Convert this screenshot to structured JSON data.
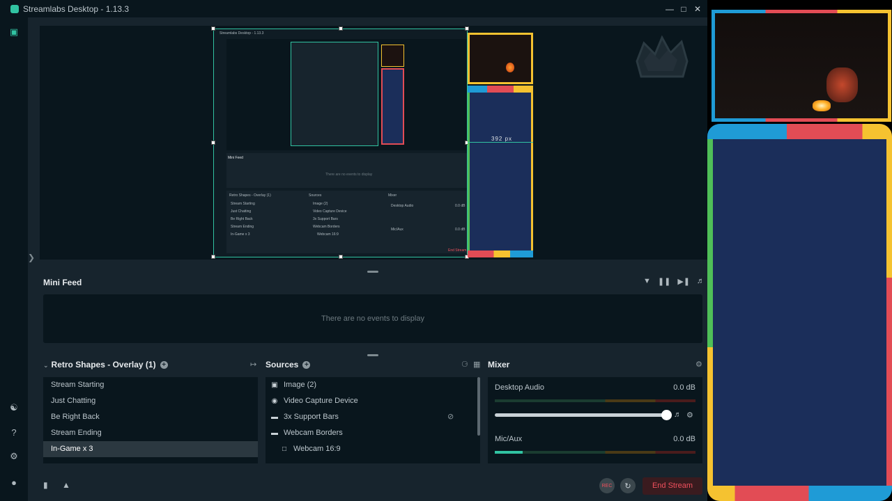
{
  "window": {
    "title": "Streamlabs Desktop - 1.13.3",
    "controls": [
      "minimize",
      "maximize",
      "close"
    ]
  },
  "nav": {
    "icons": [
      "studio-icon",
      "themes-icon",
      "help-icon",
      "settings-icon",
      "profile-icon"
    ]
  },
  "preview": {
    "nested_title": "Streamlabs Desktop - 1.13.3",
    "nested_feed_label": "Mini Feed",
    "nested_feed_empty": "There are no events to display",
    "nested_scenes_label": "Retro Shapes - Overlay (1)",
    "nested_sources_label": "Sources",
    "nested_mixer_label": "Mixer",
    "nested_desktop_audio": "Desktop Audio",
    "nested_mic": "Mic/Aux",
    "nested_db": "0.0 dB",
    "nested_end": "End Stream",
    "nested_scenes": [
      "Stream Starting",
      "Just Chatting",
      "Be Right Back",
      "Stream Ending",
      "In-Game x 3"
    ],
    "nested_sources": [
      "Image (2)",
      "Video Capture Device",
      "3x Support Bars",
      "Webcam Borders",
      "Webcam 16:9"
    ],
    "bar_height_label": "392 px"
  },
  "mini_feed": {
    "title": "Mini Feed",
    "empty_text": "There are no events to display",
    "tools": [
      "filter-icon",
      "pause-icon",
      "skip-icon",
      "volume-icon"
    ]
  },
  "scenes": {
    "title": "Retro Shapes - Overlay (1)",
    "items": [
      {
        "label": "Stream Starting",
        "active": false
      },
      {
        "label": "Just Chatting",
        "active": false
      },
      {
        "label": "Be Right Back",
        "active": false
      },
      {
        "label": "Stream Ending",
        "active": false
      },
      {
        "label": "In-Game x 3",
        "active": true
      }
    ]
  },
  "sources": {
    "title": "Sources",
    "items": [
      {
        "label": "Image (2)",
        "icon": "image-icon"
      },
      {
        "label": "Video Capture Device",
        "icon": "webcam-icon"
      },
      {
        "label": "3x Support Bars",
        "icon": "folder-icon"
      },
      {
        "label": "Webcam Borders",
        "icon": "folder-open-icon"
      },
      {
        "label": "Webcam 16:9",
        "icon": "file-icon"
      }
    ]
  },
  "mixer": {
    "title": "Mixer",
    "channels": [
      {
        "name": "Desktop Audio",
        "db": "0.0 dB",
        "level": 0.0
      },
      {
        "name": "Mic/Aux",
        "db": "0.0 dB",
        "level": 0.14
      }
    ],
    "volume": 0.88
  },
  "footer": {
    "rec_label": "REC",
    "end_stream": "End Stream"
  },
  "colors": {
    "accent": "#31c3a2",
    "panel_bg": "#17242d",
    "dark_bg": "#09161d",
    "end_stream_text": "#f0505d",
    "overlay_blue": "#1f9bd6",
    "overlay_red": "#e24c55",
    "overlay_yellow": "#f5c230",
    "overlay_green": "#4fbf58",
    "overlay_navy": "#1b2e5a"
  }
}
